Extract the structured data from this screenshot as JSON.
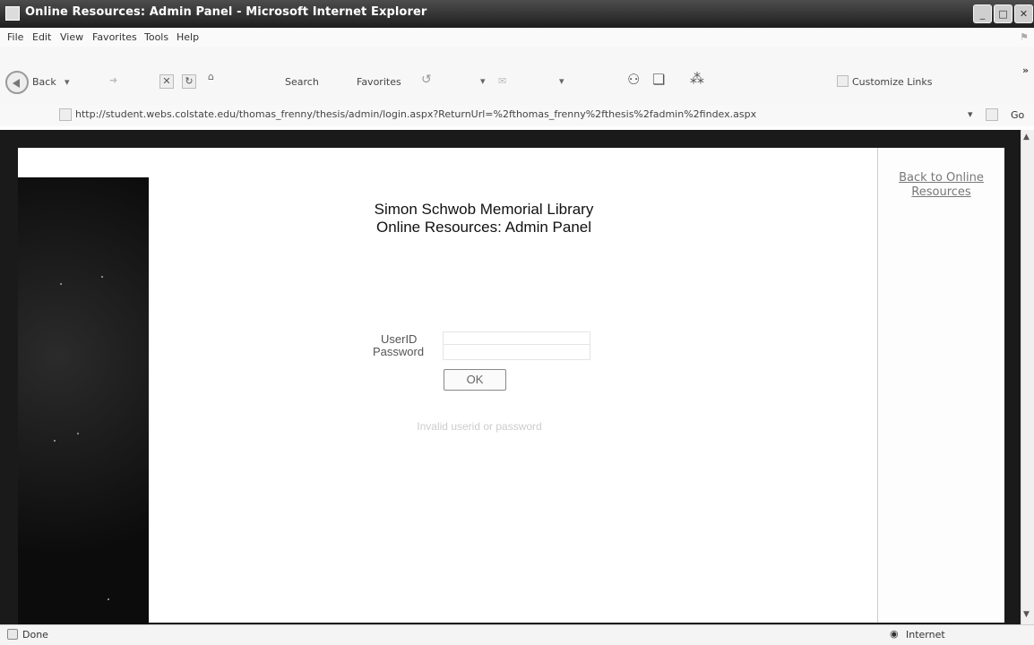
{
  "window": {
    "title": "Online Resources: Admin Panel - Microsoft Internet Explorer",
    "controls": {
      "minimize": "_",
      "maximize": "□",
      "close": "✕"
    }
  },
  "menu": {
    "items": [
      "File",
      "Edit",
      "View",
      "Favorites",
      "Tools",
      "Help"
    ]
  },
  "toolbar": {
    "back_label": "Back",
    "search_label": "Search",
    "favorites_label": "Favorites",
    "customize_links": "Customize Links",
    "more": "»"
  },
  "address": {
    "url": "http://student.webs.colstate.edu/thomas_frenny/thesis/admin/login.aspx?ReturnUrl=%2fthomas_frenny%2fthesis%2fadmin%2findex.aspx",
    "go_label": "Go"
  },
  "page": {
    "heading_line1": "Simon Schwob Memorial Library",
    "heading_line2": "Online Resources: Admin Panel",
    "back_link": "Back to Online Resources",
    "userid_label": "UserID",
    "password_label": "Password",
    "userid_value": "",
    "password_value": "",
    "ok_label": "OK",
    "error_message": "Invalid userid or password"
  },
  "status": {
    "left": "Done",
    "zone": "Internet"
  },
  "colors": {
    "titlebar": "#2e2e2e",
    "page_frame": "#1a1a1a",
    "link": "#777777",
    "error_text": "#cccccc"
  },
  "icons": {
    "back": "back-arrow-icon",
    "stop": "stop-icon",
    "refresh": "refresh-icon",
    "home": "home-icon",
    "page": "page-icon",
    "internet": "globe-icon"
  }
}
